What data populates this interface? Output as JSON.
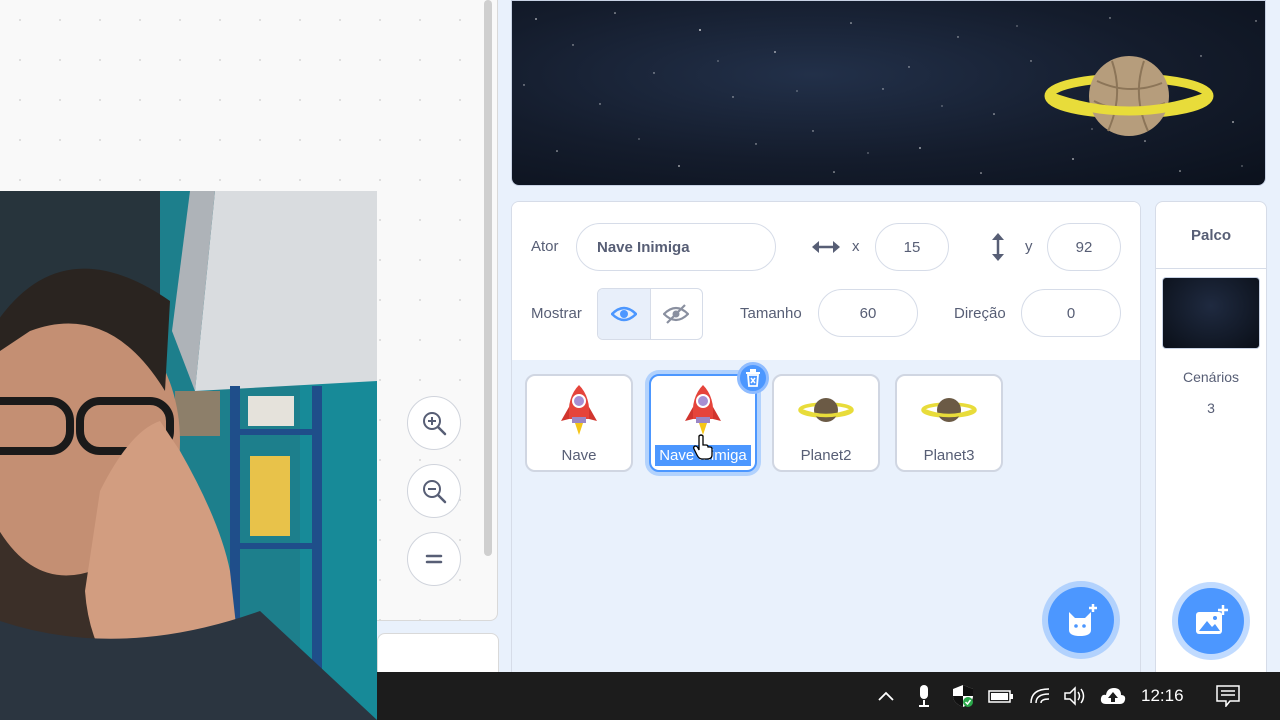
{
  "sprite_info": {
    "sprite_label": "Ator",
    "sprite_name": "Nave Inimiga",
    "x_label": "x",
    "x_value": "15",
    "y_label": "y",
    "y_value": "92",
    "show_label": "Mostrar",
    "size_label": "Tamanho",
    "size_value": "60",
    "direction_label": "Direção",
    "direction_value": "0"
  },
  "sprites": [
    {
      "name": "Nave",
      "icon": "rocket-icon"
    },
    {
      "name": "Nave Inimiga",
      "icon": "rocket-icon",
      "selected": true
    },
    {
      "name": "Planet2",
      "icon": "planet-icon"
    },
    {
      "name": "Planet3",
      "icon": "planet-icon"
    }
  ],
  "stage_panel": {
    "title": "Palco",
    "backdrops_label": "Cenários",
    "backdrops_count": "3"
  },
  "taskbar": {
    "clock": "12:16"
  },
  "colors": {
    "accent": "#4c97ff",
    "text": "#575e75",
    "panel_bg": "#e9f1fc"
  }
}
